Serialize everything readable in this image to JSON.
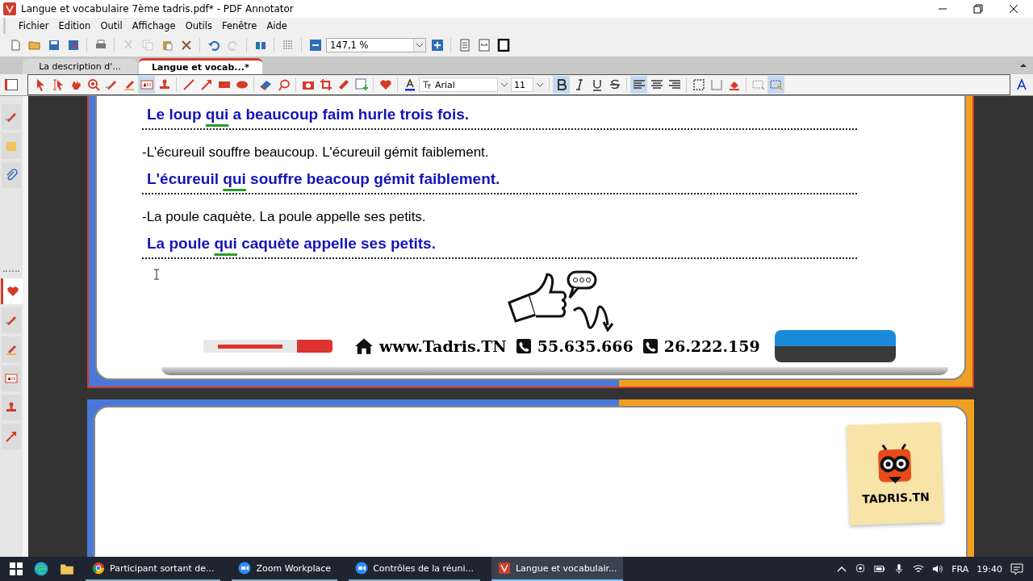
{
  "window": {
    "title": "Langue et vocabulaire 7ème tadris.pdf* - PDF Annotator"
  },
  "menu": [
    "Fichier",
    "Edition",
    "Outil",
    "Affichage",
    "Outils",
    "Fenêtre",
    "Aide"
  ],
  "toolbar": [
    {
      "kind": "new",
      "disabled": false
    },
    {
      "kind": "open",
      "disabled": false
    },
    {
      "kind": "save",
      "disabled": false
    },
    {
      "kind": "saveas",
      "disabled": false
    },
    {
      "kind": "print",
      "disabled": false
    },
    {
      "kind": "cut",
      "disabled": true
    },
    {
      "kind": "copy",
      "disabled": true
    },
    {
      "kind": "paste",
      "disabled": false
    },
    {
      "kind": "delete",
      "disabled": false
    },
    {
      "kind": "undo",
      "disabled": false
    },
    {
      "kind": "redo",
      "disabled": true
    },
    {
      "kind": "find",
      "disabled": false
    },
    {
      "kind": "layout",
      "disabled": false
    },
    {
      "kind": "zoomout",
      "disabled": false
    },
    {
      "kind": "zoomfield"
    },
    {
      "kind": "zoomin",
      "disabled": false
    },
    {
      "kind": "singlepage",
      "disabled": false
    },
    {
      "kind": "fitwidth",
      "disabled": false
    },
    {
      "kind": "fullscreen",
      "disabled": false
    }
  ],
  "zoom": {
    "value": "147,1 %"
  },
  "tabs": [
    {
      "label": "La description d'...",
      "selected": false
    },
    {
      "label": "Langue et vocab...*",
      "selected": true
    }
  ],
  "tools": [
    {
      "kind": "select",
      "selected": false
    },
    {
      "kind": "textselect",
      "selected": false
    },
    {
      "kind": "hand",
      "selected": false
    },
    {
      "kind": "zoom",
      "selected": false
    },
    {
      "kind": "pen",
      "selected": false
    },
    {
      "kind": "highlighter",
      "selected": false
    },
    {
      "kind": "textbox",
      "selected": true
    },
    {
      "kind": "stamp",
      "selected": false
    },
    {
      "kind": "line",
      "selected": false
    },
    {
      "kind": "arrow",
      "selected": false
    },
    {
      "kind": "rect",
      "selected": false
    },
    {
      "kind": "ellipse",
      "selected": false
    },
    {
      "kind": "eraser",
      "selected": false
    },
    {
      "kind": "lasso",
      "selected": false
    },
    {
      "kind": "camera",
      "selected": false
    },
    {
      "kind": "crop",
      "selected": false
    },
    {
      "kind": "ruler",
      "selected": false
    },
    {
      "kind": "image",
      "selected": false
    },
    {
      "kind": "heart",
      "selected": false
    },
    {
      "kind": "fontcolor",
      "selected": false
    },
    {
      "kind": "font",
      "value": "Arial"
    },
    {
      "kind": "size",
      "value": "11"
    },
    {
      "kind": "bold",
      "selected": true
    },
    {
      "kind": "italic",
      "selected": false
    },
    {
      "kind": "underline",
      "selected": false
    },
    {
      "kind": "strike",
      "selected": false
    },
    {
      "kind": "alignleft",
      "selected": true
    },
    {
      "kind": "aligncenter",
      "selected": false
    },
    {
      "kind": "alignright",
      "selected": false
    },
    {
      "kind": "border",
      "selected": false
    },
    {
      "kind": "frame",
      "selected": false
    },
    {
      "kind": "fill",
      "selected": false
    },
    {
      "kind": "textfit",
      "selected": false
    },
    {
      "kind": "textauto",
      "selected": true
    }
  ],
  "side_tabs": [
    {
      "kind": "pen",
      "selected": false
    },
    {
      "kind": "note",
      "selected": false
    },
    {
      "kind": "clip",
      "selected": false
    }
  ],
  "favorites": [
    {
      "kind": "heart",
      "selected": true
    },
    {
      "kind": "pen",
      "selected": false
    },
    {
      "kind": "highlighter",
      "selected": false
    },
    {
      "kind": "textbox",
      "selected": false
    },
    {
      "kind": "stamp",
      "selected": false
    },
    {
      "kind": "arrow",
      "selected": false
    }
  ],
  "document": {
    "lines": [
      {
        "kind": "answer",
        "pre": "Le loup ",
        "mark": "qui",
        "post": " a beaucoup faim hurle trois fois."
      },
      {
        "kind": "prompt",
        "text": "-L'écureuil souffre beaucoup. L'écureuil gémit faiblement."
      },
      {
        "kind": "answer",
        "pre": "L'écureuil ",
        "mark": "qui",
        "post": " souffre beacoup gémit faiblement."
      },
      {
        "kind": "prompt",
        "text": "-La poule caquète. La poule appelle ses petits."
      },
      {
        "kind": "answer",
        "pre": "La poule ",
        "mark": "qui",
        "post": " caquète appelle ses petits."
      }
    ],
    "footer": {
      "website": "www.Tadris.TN",
      "phones": [
        "55.635.666",
        "26.222.159"
      ]
    },
    "logo": "TADRIS.TN"
  },
  "taskbar": {
    "apps": [
      {
        "kind": "chrome",
        "label": "Participant sortant de...",
        "selected": false
      },
      {
        "kind": "zoom",
        "label": "Zoom Workplace",
        "selected": false
      },
      {
        "kind": "zoom",
        "label": "Contrôles de la réuni...",
        "selected": false
      },
      {
        "kind": "pdf",
        "label": "Langue et vocabulair...",
        "selected": true
      }
    ],
    "language": "FRA",
    "time": "19:40"
  }
}
